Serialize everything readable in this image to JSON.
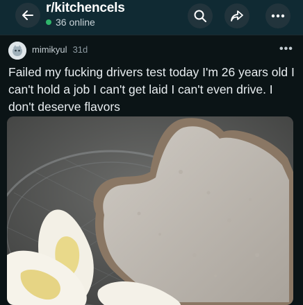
{
  "header": {
    "subreddit": "r/kitchencels",
    "online": "36 online",
    "icons": {
      "back": "back-arrow-icon",
      "search": "search-icon",
      "share": "share-icon",
      "more": "more-horizontal-icon"
    }
  },
  "post": {
    "author": "mimikyul",
    "age": "31d",
    "more_label": "•••",
    "text": "Failed my fucking drivers test today I'm 26 years old I can't hold a job I can't get laid I can't even drive. I don't deserve flavors",
    "image_description_icon": "photo"
  },
  "colors": {
    "header_bg": "#102a33",
    "page_bg": "#0b1416",
    "online_dot": "#2fb56b"
  }
}
